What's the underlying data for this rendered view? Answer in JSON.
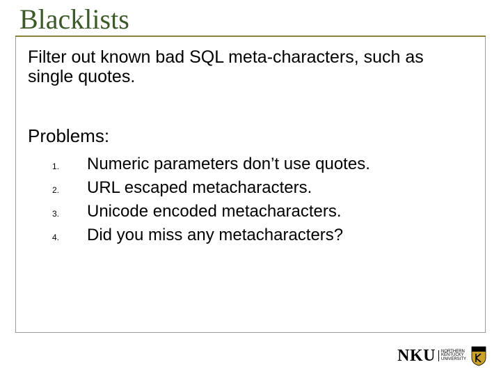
{
  "title": "Blacklists",
  "intro": "Filter out known bad SQL meta-characters, such as single quotes.",
  "problems_label": "Problems:",
  "items": [
    {
      "n": "1.",
      "text": "Numeric parameters don’t use quotes."
    },
    {
      "n": "2.",
      "text": "URL escaped metacharacters."
    },
    {
      "n": "3.",
      "text": "Unicode encoded metacharacters."
    },
    {
      "n": "4.",
      "text": "Did you miss any metacharacters?"
    }
  ],
  "logo": {
    "initials": "NKU",
    "line1": "NORTHERN",
    "line2": "KENTUCKY",
    "line3": "UNIVERSITY"
  }
}
